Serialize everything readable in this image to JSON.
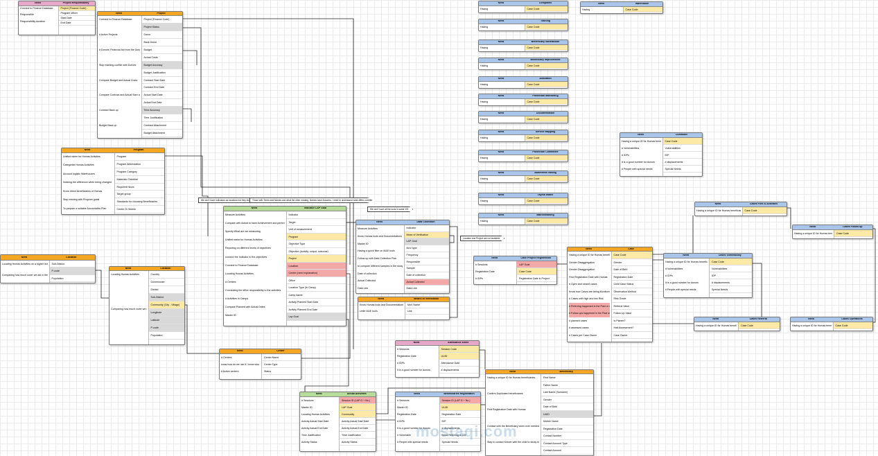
{
  "headers": {
    "need": "Need"
  },
  "colors": {
    "orange": "#f5a623",
    "pink": "#e6a8c8",
    "green": "#b7dc9a",
    "blue": "#a9c6ea",
    "yellow": "#fde9a6",
    "red": "#f4a9a9",
    "gray": "#d9d9d9",
    "line": "#222222"
  },
  "notes": [
    "We don't have Indicators as locations but they should. Locations are not Community at higher levels",
    "Those with Terms and Names and what the other existing, Names have Answers, I need to understand what differs a better",
    "We don't have all the tools in same VIS",
    "Location and Project are not available"
  ],
  "watermark": "mostaqi.com",
  "tables": [
    {
      "name": "Project Responsibility",
      "color": "pink",
      "needs": [
        "Connect to Finance Database",
        "Responsible",
        "Responsibility duration"
      ],
      "fields": [
        "Project (Finance Code)",
        "Program officer",
        "Start Date",
        "End Date"
      ]
    },
    {
      "name": "Project",
      "color": "orange",
      "needs": [
        "Connect to Finance Database",
        "# Active Projects",
        "# Donors' Financial Aid from the Donor",
        "Stop marking conflict with Donors",
        "Compare Budget and Actual Costs",
        "Compare Contract and Actual Start and End Dates",
        "Contract Back up",
        "Budget Back up"
      ],
      "fields": [
        "Project (Finance Code)",
        "Project Status",
        "Donor",
        "Back Donor",
        "Budget",
        "Actual Costs",
        "Budget Accuracy",
        "Budget Justification",
        "Contract Start Date",
        "Contract End Date",
        "Actual Start Date",
        "Actual End Date",
        "Time Accuracy",
        "Time Justification",
        "Contract Attachment",
        "Budget Attachment"
      ]
    },
    {
      "name": "Program",
      "color": "orange",
      "needs": [
        "Unified name for Humas Activities",
        "Categorize Humas Activities",
        "Account logistic Warehouses",
        "Noticing the difference when being changed",
        "Know direct beneficiaries of Humas",
        "Stop missing with Program goals",
        "To prepare a suitable Accountable Plan"
      ],
      "fields": [
        "Program",
        "Program Abbreviation",
        "Program Category",
        "Materials Checklist",
        "Required Hours",
        "Target group",
        "Standards for choosing Beneficiaries",
        "Center Or Mobile"
      ]
    },
    {
      "name": "Location",
      "color": "orange",
      "needs": [
        "Locating Humas Activities on a higher level for security",
        "Comparing how much cover we did in the targeted location"
      ],
      "fields": [
        "Sub-District",
        "P-code",
        "Population"
      ]
    },
    {
      "name": "Location",
      "color": "orange",
      "needs": [
        "Locating Humas Activities",
        "Comparing how much cover we did in the targeted location"
      ],
      "fields": [
        "Country",
        "Governorate",
        "District",
        "Sub-District",
        "Community (City - Village)",
        "Longitude",
        "Latitude",
        "P-code",
        "Population"
      ]
    },
    {
      "name": "Indicator LAP Goal",
      "color": "green",
      "needs": [
        "Measure Activities",
        "Compare with Actual to have Achievement and performance",
        "Specify What are we measuring",
        "Unified name for Humas Activities",
        "Reporting on different levels of objectives",
        "connect the Indicator to the objectives",
        "Connect to Finance Database",
        "Locating Humas Activities",
        "# Centers",
        "Connecting the office responsibility to the activities",
        "# Activities in Camps",
        "Compare Planned with Actual Dates",
        "Master ID"
      ],
      "fields": [
        "Indicator",
        "Target",
        "Unit of measurement",
        "Program",
        "Objective Type",
        "Objective (Activity, output, outcome)",
        "Project",
        "Location",
        "Center (need explanation)",
        "Office",
        "Location Type (In Camp)",
        "Camp Name",
        "Activity Planned Start Date",
        "Activity Planned End Date",
        "Lap Goal"
      ]
    },
    {
      "name": "Data Collection",
      "color": "blue",
      "needs": [
        "Measure Activities",
        "Know Humas tools and Documentations",
        "Master ID",
        "Having a quick filter on M&E tools",
        "Follow up with Data Collection Plan",
        "to compare different samples in the study",
        "Date of collection",
        "Actual Collected",
        "Data Link"
      ],
      "fields": [
        "Indicator",
        "Mean of Verification",
        "LAP Goal",
        "MoV type",
        "Frequency",
        "Responsible",
        "Sample",
        "Date of collection",
        "Actual Collected",
        "Data Link"
      ]
    },
    {
      "name": "Means of Verification",
      "color": "orange",
      "needs": [
        "Know Humas tools and Documentations",
        "Unite M&E tools"
      ],
      "fields": [
        "MoV Name",
        "Link"
      ]
    },
    {
      "name": "Center",
      "color": "orange",
      "needs": [
        "# Centers",
        "know how do we use it / know who owns it",
        "# Active centers"
      ],
      "fields": [
        "Center Name",
        "Center Type",
        "Status"
      ]
    },
    {
      "name": "Actual Activities",
      "color": "green",
      "needs": [
        "# Sessions",
        "Master ID",
        "Locating Humas Activities",
        "Activity Actual Start Date",
        "Activity Actual End Date",
        "Time Justification",
        "Activity Status"
      ],
      "fields": [
        "Session ID (LAP G + No.)",
        "LAP Goal",
        "Community",
        "Activity Actual Start Date",
        "Activity Actual End Date",
        "Time Justification",
        "Activity Status"
      ]
    },
    {
      "name": "Beneficiaries Registration",
      "color": "blue",
      "needs": [
        "# Sessions",
        "Master ID",
        "Registration Date",
        "# IDPs",
        "It is a good number for donors",
        "# Vulnerable",
        "# People with special needs"
      ],
      "fields": [
        "Session ID (LAP G + No.)",
        "UUID",
        "Registration Date",
        "IDP",
        "# displacements",
        "Need Referring to CM",
        "Special Needs"
      ]
    },
    {
      "name": "Attendance sheet",
      "color": "pink",
      "needs": [
        "# Sessions",
        "Registration Date",
        "# IDPs",
        "It is a good number for donors"
      ],
      "fields": [
        "Session Code",
        "UUID",
        "Attendance Date",
        "# displacements"
      ]
    },
    {
      "name": "Beneficiary",
      "color": "orange",
      "needs": [
        "Having a unique ID for Humas beneficiaries",
        "Confirm Duplicated beneficiaries",
        "First Registration Date with Humas",
        "Contact with the Beneficiary when ever needed",
        "Stay in contact forever with the child to study his history more in depth"
      ],
      "fields": [
        "First Name",
        "Father Name",
        "Last Name (Surname)",
        "Gender",
        "Date of Birth",
        "UUID",
        "Mother Name",
        "Registration Date",
        "Contact Number",
        "Contact Account Type",
        "Contact Account"
      ]
    },
    {
      "name": "Case Project Registration",
      "color": "blue",
      "needs": [
        "# Sessions",
        "Registration Date",
        "# IDPs"
      ],
      "fields": [
        "LAP Goal",
        "Case Code",
        "Registration Date in Project"
      ]
    },
    {
      "name": "Case",
      "color": "orange",
      "needs": [
        "Having a unique ID for Humas beneficiaries",
        "Gender Disaggregation",
        "Gender Disaggregation",
        "First Registration Date with Humas",
        "# Open and closed cases",
        "Know how Cases are being Monitored",
        "# Cases with high and low Risk",
        "# Referring happened in the Past or now",
        "# Follow ups happened in the Past or now",
        "# planned cases",
        "# assessed cases",
        "# Cases per Case Owner"
      ],
      "fields": [
        "Case Code",
        "Gender",
        "Date of Birth",
        "Registration Date",
        "Child Case Status",
        "Observation Method",
        "Risk Grade",
        "Referral Value",
        "Follow Up Value",
        "Is Planed?",
        "Had Assessment?",
        "Case Owner"
      ]
    },
    {
      "name": "Cases Vulnerability",
      "color": "blue",
      "needs": [
        "Having a unique ID for Humas beneficiaries",
        "# Vulnerabilities",
        "# IDPs",
        "It is a good number for donors",
        "# People with special needs"
      ],
      "fields": [
        "Case Code",
        "Vulnerabilities",
        "IDP",
        "# displacements",
        "Special Needs"
      ]
    },
    {
      "name": "Cummitee",
      "color": "blue",
      "needs": [
        "Having a unique ID for Humas beneficiaries",
        "# Vulnerabilities",
        "# IDPs",
        "It is a good number for donors",
        "# People with special needs"
      ],
      "fields": [
        "Case Code",
        "Vulnerabilities",
        "IDP",
        "# displacements",
        "Special Needs"
      ]
    },
    {
      "name": "Cases Files & Activities",
      "color": "blue",
      "needs": [
        "Having a unique ID for Humas beneficiaries"
      ],
      "fields": [
        "Case Code"
      ]
    },
    {
      "name": "Cases Follow up",
      "color": "blue",
      "needs": [
        "Having a unique ID for Humas beneficiaries"
      ],
      "fields": [
        "Case Code"
      ]
    },
    {
      "name": "Cases Referral",
      "color": "blue",
      "needs": [
        "Having a unique ID for Humas beneficiaries"
      ],
      "fields": [
        "Case Code"
      ]
    },
    {
      "name": "Cases Operations",
      "color": "blue",
      "needs": [
        "Having a unique ID for Humas beneficiaries"
      ],
      "fields": [
        "Case Code"
      ]
    },
    {
      "name": "Warehouse",
      "color": "blue",
      "needs": [
        "Having"
      ],
      "fields": [
        "Case Code"
      ]
    },
    {
      "name": "Complains",
      "color": "blue",
      "needs": [
        "Having"
      ],
      "fields": [
        "Case Code"
      ]
    },
    {
      "name": "Training",
      "color": "blue",
      "needs": [
        "Having"
      ],
      "fields": [
        "Case Code"
      ]
    },
    {
      "name": "Beneficiary Satisfaction",
      "color": "blue",
      "needs": [
        "Having"
      ],
      "fields": [
        "Case Code"
      ]
    },
    {
      "name": "Beneficiary Improvement",
      "color": "blue",
      "needs": [
        "Having"
      ],
      "fields": [
        "Case Code"
      ]
    },
    {
      "name": "Allocation",
      "color": "blue",
      "needs": [
        "Having"
      ],
      "fields": [
        "Case Code"
      ]
    },
    {
      "name": "Protection Monitoring",
      "color": "blue",
      "needs": [
        "Having"
      ],
      "fields": [
        "Case Code"
      ]
    },
    {
      "name": "Documentation",
      "color": "blue",
      "needs": [
        "Having"
      ],
      "fields": [
        "Case Code"
      ]
    },
    {
      "name": "Service Mapping",
      "color": "blue",
      "needs": [
        "Having"
      ],
      "fields": [
        "Case Code"
      ]
    },
    {
      "name": "Protection Committee",
      "color": "blue",
      "needs": [
        "Having"
      ],
      "fields": [
        "Case Code"
      ]
    },
    {
      "name": "Awareness raising",
      "color": "blue",
      "needs": [
        "Having"
      ],
      "fields": [
        "Case Code"
      ]
    },
    {
      "name": "Tayma Watch",
      "color": "blue",
      "needs": [
        "Having"
      ],
      "fields": [
        "Case Code"
      ]
    },
    {
      "name": "Mainstreaming",
      "color": "blue",
      "needs": [
        "Having"
      ],
      "fields": [
        "Case Code"
      ]
    }
  ]
}
